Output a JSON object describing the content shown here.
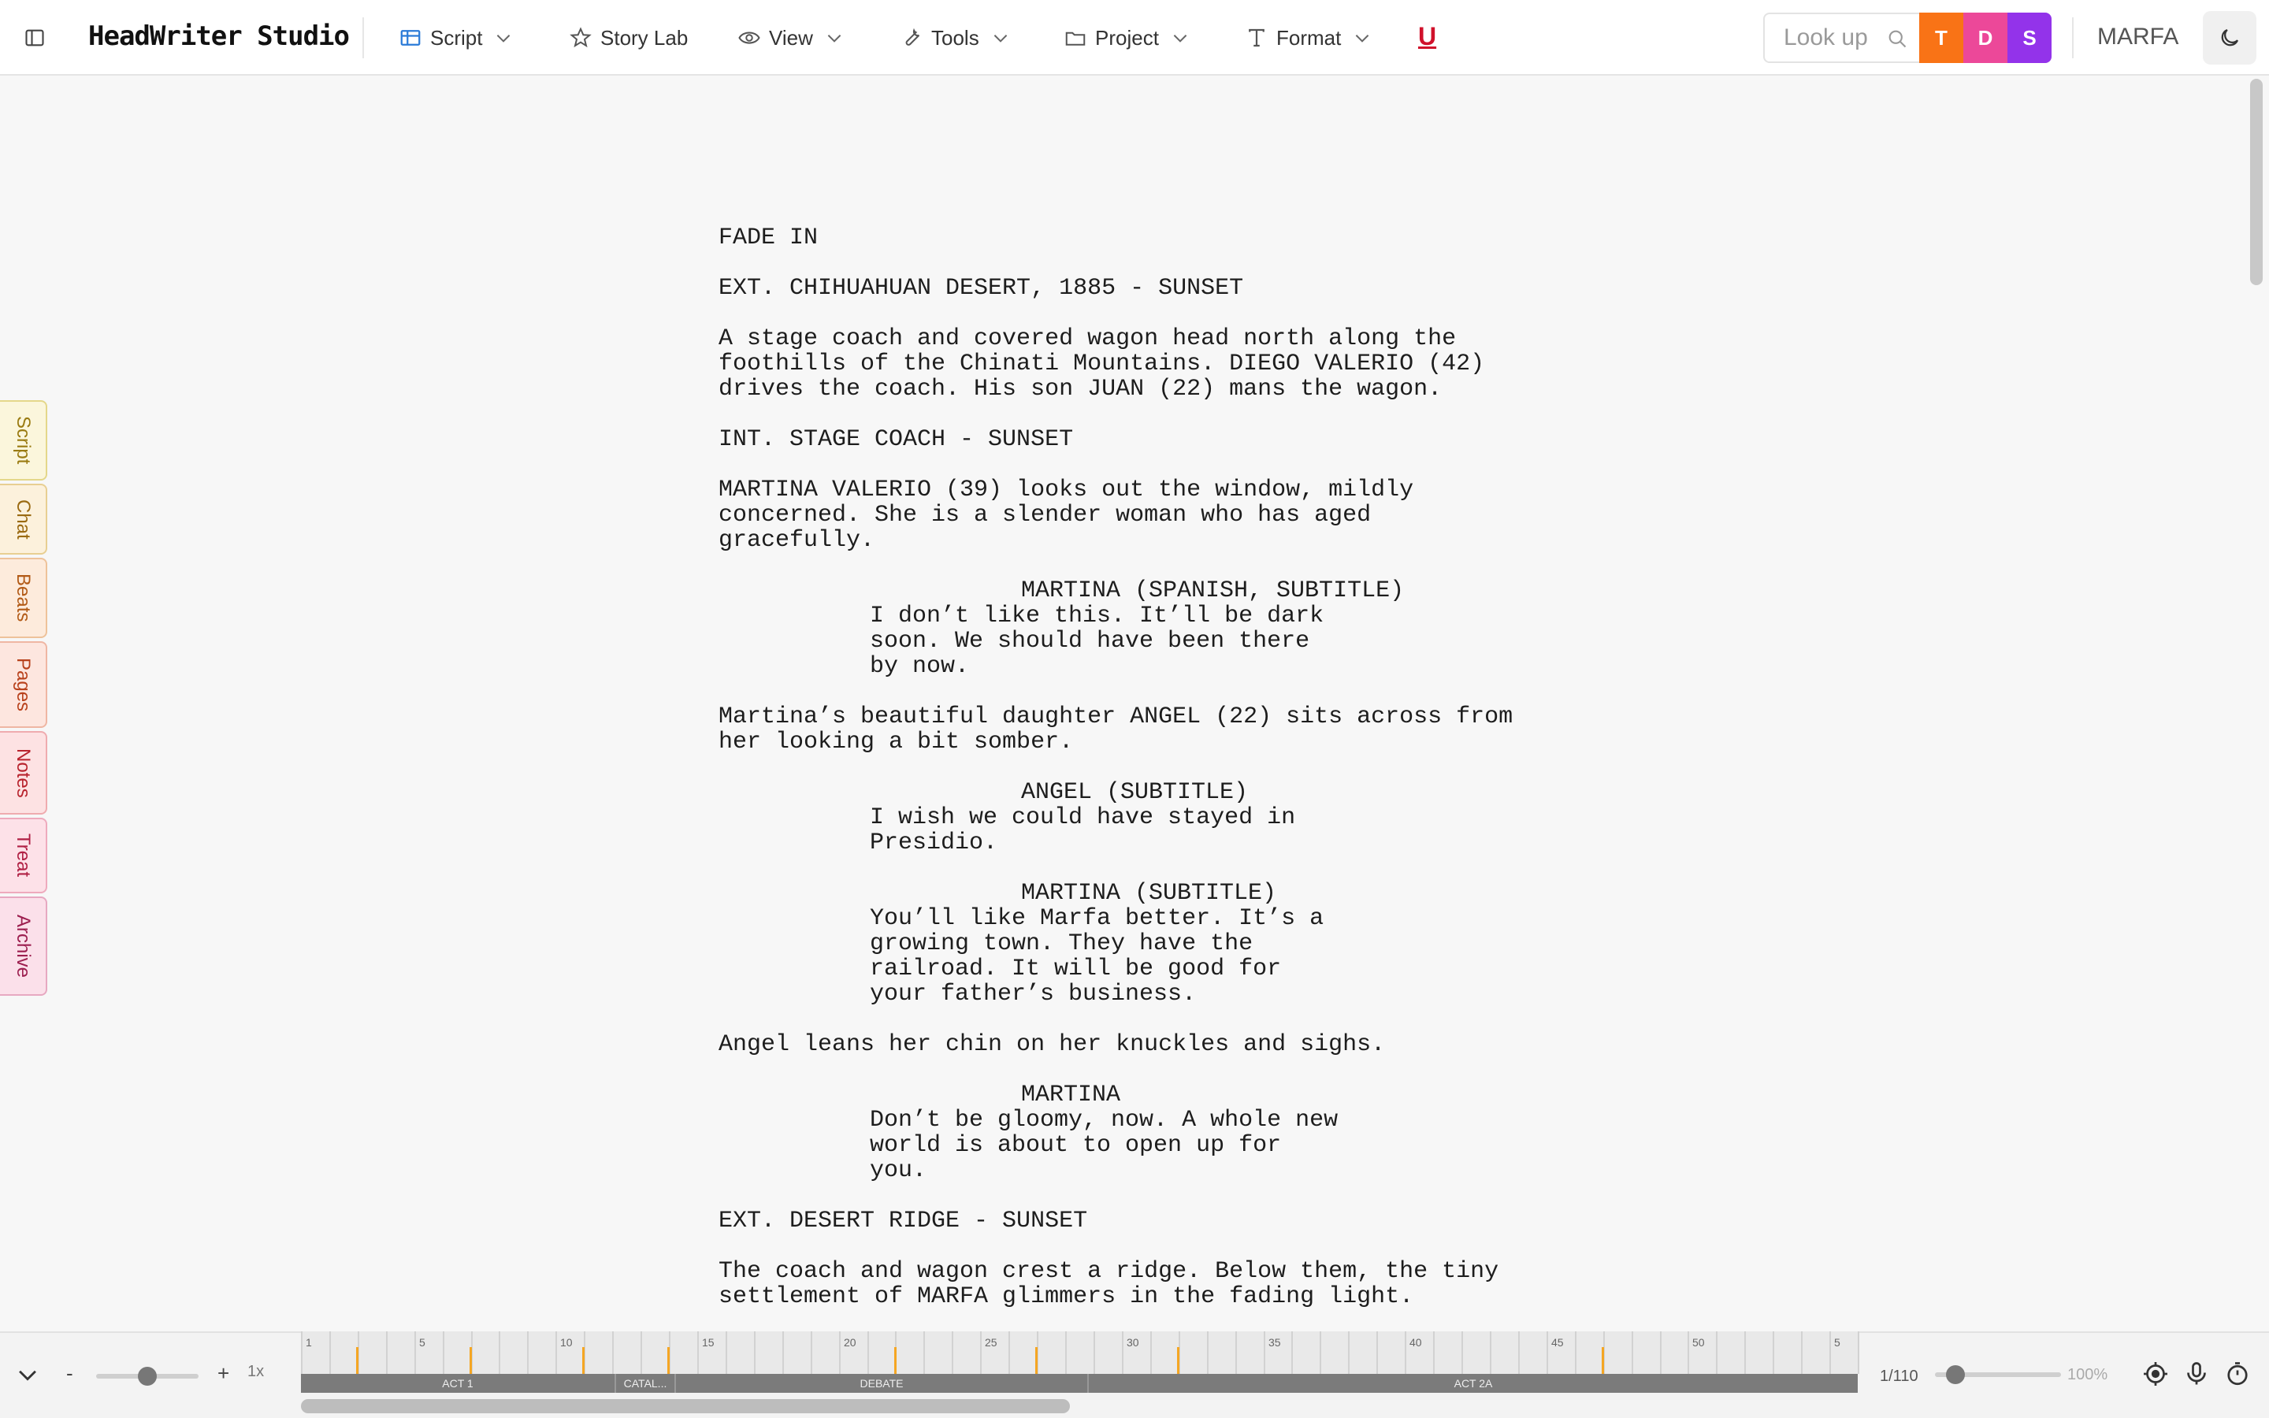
{
  "app": {
    "title": "HeadWriter Studio",
    "project_name": "MARFA"
  },
  "menus": [
    {
      "label": "Script",
      "icon": "table-icon"
    },
    {
      "label": "Story Lab",
      "icon": "star-icon"
    },
    {
      "label": "View",
      "icon": "eye-icon"
    },
    {
      "label": "Tools",
      "icon": "wrench-icon"
    },
    {
      "label": "Project",
      "icon": "folder-icon"
    },
    {
      "label": "Format",
      "icon": "text-format-icon"
    }
  ],
  "underline_button": "U",
  "lookup": {
    "placeholder": "Look up"
  },
  "mode_buttons": {
    "t": "T",
    "d": "D",
    "s": "S"
  },
  "colors": {
    "t": "#f97316",
    "d": "#ec4899",
    "s": "#9333ea",
    "underline": "#d0112b"
  },
  "side_tabs": [
    {
      "label": "Script",
      "color": "#9a7b12",
      "bg": "#fbf6dc",
      "border": "#e4d78a"
    },
    {
      "label": "Chat",
      "color": "#9a6a12",
      "bg": "#fcf1dc",
      "border": "#e8cf92"
    },
    {
      "label": "Beats",
      "color": "#b25a16",
      "bg": "#fdebdc",
      "border": "#eec29a"
    },
    {
      "label": "Pages",
      "color": "#b8411c",
      "bg": "#fde6df",
      "border": "#efb6a3"
    },
    {
      "label": "Notes",
      "color": "#b8232d",
      "bg": "#fde2e3",
      "border": "#efabaf"
    },
    {
      "label": "Treat",
      "color": "#b02044",
      "bg": "#fde1e8",
      "border": "#eeaabd"
    },
    {
      "label": "Archive",
      "color": "#9c1f4f",
      "bg": "#fbe0ea",
      "border": "#e7a8c1"
    }
  ],
  "script": {
    "fade_in": "FADE IN",
    "scene1_heading": "EXT. CHIHUAHUAN DESERT, 1885 - SUNSET",
    "scene1_action": "A stage coach and covered wagon head north along the\nfoothills of the Chinati Mountains. DIEGO VALERIO (42)\ndrives the coach. His son JUAN (22) mans the wagon.",
    "scene2_heading": "INT. STAGE COACH - SUNSET",
    "scene2_action": "MARTINA VALERIO (39) looks out the window, mildly\nconcerned. She is a slender woman who has aged\ngracefully.",
    "char1": "MARTINA (SPANISH, SUBTITLE)",
    "dlg1": "I don’t like this. It’ll be dark\nsoon. We should have been there\nby now.",
    "action3": "Martina’s beautiful daughter ANGEL (22) sits across from\nher looking a bit somber.",
    "char2": "ANGEL (SUBTITLE)",
    "dlg2": "I wish we could have stayed in\nPresidio.",
    "char3": "MARTINA (SUBTITLE)",
    "dlg3": "You’ll like Marfa better. It’s a\ngrowing town. They have the\nrailroad. It will be good for\nyour father’s business.",
    "action4": "Angel leans her chin on her knuckles and sighs.",
    "char4": "MARTINA",
    "dlg4": "Don’t be gloomy, now. A whole new\nworld is about to open up for\nyou.",
    "scene3_heading": "EXT. DESERT RIDGE - SUNSET",
    "scene3_action": "The coach and wagon crest a ridge. Below them, the tiny\nsettlement of MARFA glimmers in the fading light."
  },
  "bottom": {
    "zoom_minus": "-",
    "zoom_plus": "+",
    "zoom_label": "1x",
    "zoom_level": 0.5,
    "page_count": "1/110",
    "page_zoom": "100%",
    "timeline_numbers": [
      "1",
      "5",
      "10",
      "15",
      "20",
      "25",
      "30",
      "35",
      "40",
      "45",
      "50",
      "5"
    ],
    "acts": [
      "ACT 1",
      "CATAL...",
      "DEBATE",
      "ACT 2A"
    ]
  }
}
